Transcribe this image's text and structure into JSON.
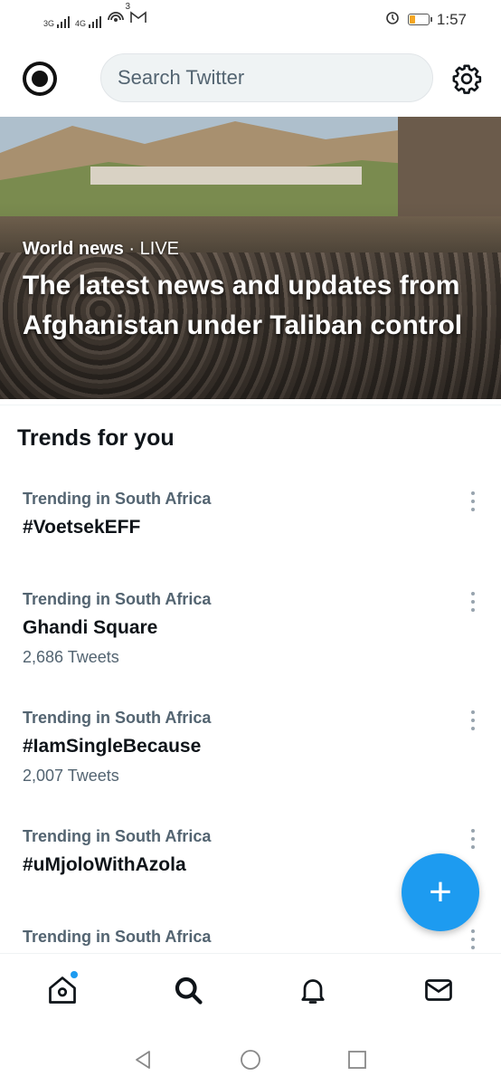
{
  "status_bar": {
    "net1": "3G",
    "net2": "4G",
    "notif_count": "3",
    "time": "1:57"
  },
  "header": {
    "search_placeholder": "Search Twitter"
  },
  "hero": {
    "category": "World news",
    "separator": " · ",
    "live": "LIVE",
    "headline": "The latest news and updates from Afghanistan under Taliban control"
  },
  "trends": {
    "title": "Trends for you",
    "items": [
      {
        "context": "Trending in South Africa",
        "name": "#VoetsekEFF",
        "count": ""
      },
      {
        "context": "Trending in South Africa",
        "name": "Ghandi Square",
        "count": "2,686 Tweets"
      },
      {
        "context": "Trending in South Africa",
        "name": "#IamSingleBecause",
        "count": "2,007 Tweets"
      },
      {
        "context": "Trending in South Africa",
        "name": "#uMjoloWithAzola",
        "count": ""
      },
      {
        "context": "Trending in South Africa",
        "name": "",
        "count": ""
      }
    ]
  },
  "fab": {
    "label": "+"
  },
  "colors": {
    "accent": "#1d9bf0",
    "secondary_text": "#536471"
  },
  "icons": [
    "home-icon",
    "search-icon",
    "bell-icon",
    "mail-icon",
    "gear-icon",
    "back-icon",
    "home-circle-icon",
    "recents-icon"
  ]
}
